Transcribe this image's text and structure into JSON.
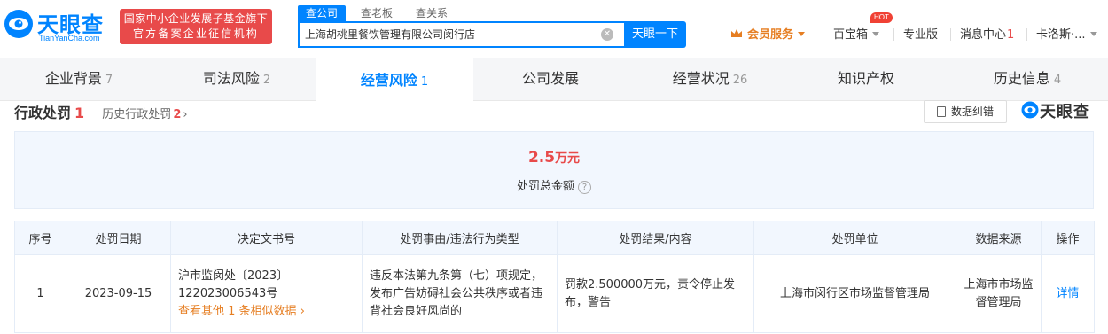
{
  "brand": {
    "name": "天眼查",
    "subtitle": "TianYanCha.com",
    "gov_line1": "国家中小企业发展子基金旗下",
    "gov_line2": "官方备案企业征信机构"
  },
  "search": {
    "tabs": [
      "查公司",
      "查老板",
      "查关系"
    ],
    "value": "上海胡桃里餐饮管理有限公司闵行店",
    "button": "天眼一下"
  },
  "topnav": {
    "vip": "会员服务",
    "toolbox": "百宝箱",
    "hot": "HOT",
    "pro": "专业版",
    "messages": "消息中心",
    "messages_count": "1",
    "user": "卡洛斯·..."
  },
  "tabs": [
    {
      "label": "企业背景",
      "count": "7"
    },
    {
      "label": "司法风险",
      "count": "2"
    },
    {
      "label": "经营风险",
      "count": "1"
    },
    {
      "label": "公司发展",
      "count": ""
    },
    {
      "label": "经营状况",
      "count": "26"
    },
    {
      "label": "知识产权",
      "count": ""
    },
    {
      "label": "历史信息",
      "count": "4"
    }
  ],
  "section": {
    "title": "行政处罚",
    "count": "1",
    "history_label": "历史行政处罚",
    "history_count": "2",
    "error_button": "数据纠错",
    "brand_small": "天眼查"
  },
  "summary": {
    "amount": "2.5",
    "unit": "万元",
    "label": "处罚总金额"
  },
  "table": {
    "headers": [
      "序号",
      "处罚日期",
      "决定文书号",
      "处罚事由/违法行为类型",
      "处罚结果/内容",
      "处罚单位",
      "数据来源",
      "操作"
    ],
    "rows": [
      {
        "index": "1",
        "date": "2023-09-15",
        "doc_no_line1": "沪市监闵处〔2023〕",
        "doc_no_line2": "122023006543号",
        "similar_link": "查看其他 1 条相似数据",
        "reason": "违反本法第九条第（七）项规定，发布广告妨碍社会公共秩序或者违背社会良好风尚的",
        "result": "罚款2.500000万元，责令停止发布，警告",
        "authority": "上海市闵行区市场监督管理局",
        "source": "上海市市场监督管理局",
        "action": "详情"
      }
    ]
  },
  "colors": {
    "brand_blue": "#0084ff",
    "alert_red": "#e84a4a",
    "vip_orange": "#e67e22"
  }
}
